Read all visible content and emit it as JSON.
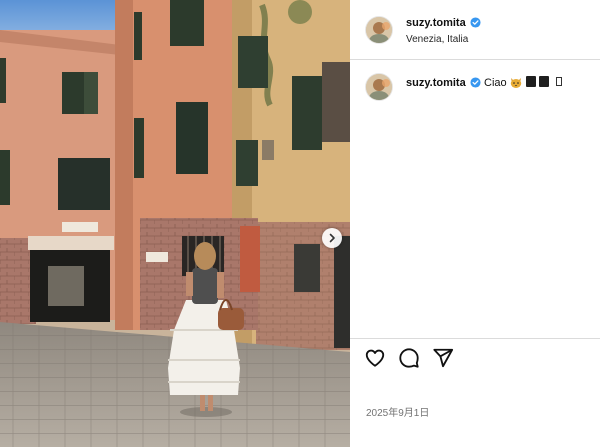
{
  "post": {
    "username": "suzy.tomita",
    "location": "Venezia, Italia",
    "caption": "Ciao",
    "caption_emoji": "cat-face-emoji",
    "date": "2025年9月1日"
  },
  "image": {
    "description_icon": "venice-street-photo",
    "next_icon": "chevron-right-icon"
  },
  "actions": {
    "like_icon": "heart-icon",
    "comment_icon": "comment-bubble-icon",
    "share_icon": "paper-plane-icon"
  },
  "colors": {
    "verified": "#3897f0",
    "text": "#111111",
    "muted": "#737373",
    "divider": "#dbdbdb"
  }
}
